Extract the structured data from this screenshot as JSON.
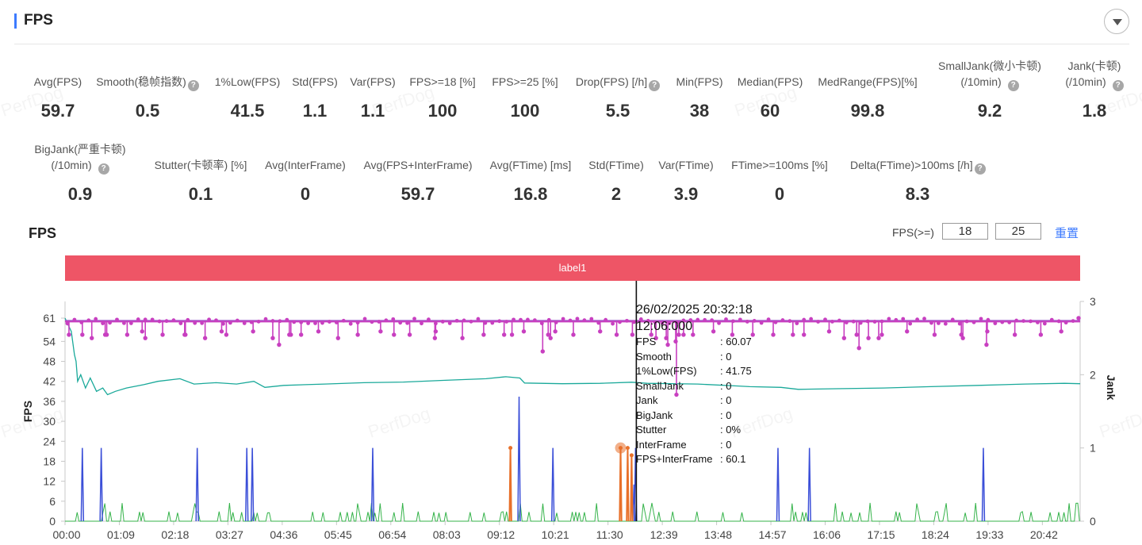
{
  "header": {
    "title": "FPS"
  },
  "metrics_row1": [
    {
      "label": "Avg(FPS)",
      "value": "59.7",
      "help": false
    },
    {
      "label": "Smooth(稳帧指数)",
      "value": "0.5",
      "help": true
    },
    {
      "label": "1%Low(FPS)",
      "value": "41.5",
      "help": false
    },
    {
      "label": "Std(FPS)",
      "value": "1.1",
      "help": false
    },
    {
      "label": "Var(FPS)",
      "value": "1.1",
      "help": false
    },
    {
      "label": "FPS>=18 [%]",
      "value": "100",
      "help": false
    },
    {
      "label": "FPS>=25 [%]",
      "value": "100",
      "help": false
    },
    {
      "label": "Drop(FPS) [/h]",
      "value": "5.5",
      "help": true
    },
    {
      "label": "Min(FPS)",
      "value": "38",
      "help": false
    },
    {
      "label": "Median(FPS)",
      "value": "60",
      "help": false
    },
    {
      "label": "MedRange(FPS)[%]",
      "value": "99.8",
      "help": false
    },
    {
      "label": "SmallJank(微小卡顿)",
      "label2": "(/10min)",
      "value": "9.2",
      "help": true
    },
    {
      "label": "Jank(卡顿)",
      "label2": "(/10min)",
      "value": "1.8",
      "help": true
    }
  ],
  "metrics_row2": [
    {
      "label": "BigJank(严重卡顿)",
      "label2": "(/10min)",
      "value": "0.9",
      "help": true
    },
    {
      "label": "Stutter(卡顿率) [%]",
      "value": "0.1",
      "help": false
    },
    {
      "label": "Avg(InterFrame)",
      "value": "0",
      "help": false
    },
    {
      "label": "Avg(FPS+InterFrame)",
      "value": "59.7",
      "help": false
    },
    {
      "label": "Avg(FTime) [ms]",
      "value": "16.8",
      "help": false
    },
    {
      "label": "Std(FTime)",
      "value": "2",
      "help": false
    },
    {
      "label": "Var(FTime)",
      "value": "3.9",
      "help": false
    },
    {
      "label": "FTime>=100ms [%]",
      "value": "0",
      "help": false
    },
    {
      "label": "Delta(FTime)>100ms [/h]",
      "value": "8.3",
      "help": true
    }
  ],
  "chart_section": {
    "title": "FPS",
    "threshold_label": "FPS(>=)",
    "threshold_low": "18",
    "threshold_high": "25",
    "reset_label": "重置",
    "band_label": "label1",
    "watermark": "PerfDog"
  },
  "tooltip": {
    "datetime": "26/02/2025 20:32:18",
    "elapsed": "12:06:000",
    "rows": [
      {
        "key": "FPS",
        "value": ": 60.07"
      },
      {
        "key": "Smooth",
        "value": ": 0"
      },
      {
        "key": "1%Low(FPS)",
        "value": ": 41.75"
      },
      {
        "key": "SmallJank",
        "value": ": 0"
      },
      {
        "key": "Jank",
        "value": ": 0"
      },
      {
        "key": "BigJank",
        "value": ": 0"
      },
      {
        "key": "Stutter",
        "value": ": 0%"
      },
      {
        "key": "InterFrame",
        "value": ": 0"
      },
      {
        "key": "FPS+InterFrame",
        "value": ": 60.1"
      }
    ]
  },
  "colors": {
    "fps": "#c83fc0",
    "low1": "#1aa99a",
    "jank": "#3b4fd8",
    "bigjank": "#e8702a",
    "smooth": "#35b34a",
    "band": "#ee5566",
    "accent": "#3d7bff"
  },
  "chart_data": {
    "type": "line",
    "xlabel": "",
    "ylabel": "FPS",
    "y2label": "Jank",
    "x_ticks": [
      "00:00",
      "01:09",
      "02:18",
      "03:27",
      "04:36",
      "05:45",
      "06:54",
      "08:03",
      "09:12",
      "10:21",
      "11:30",
      "12:39",
      "13:48",
      "14:57",
      "16:06",
      "17:15",
      "18:24",
      "19:33",
      "20:42"
    ],
    "x_range_minutes": [
      0,
      1290
    ],
    "y_ticks": [
      0,
      6,
      12,
      18,
      24,
      30,
      36,
      42,
      48,
      54,
      61
    ],
    "ylim": [
      0,
      66
    ],
    "y2_ticks": [
      0,
      1,
      2,
      3
    ],
    "y2lim": [
      0,
      3
    ],
    "cursor_minutes": 726,
    "series": [
      {
        "name": "FPS",
        "baseline": 60.07,
        "dips": [
          [
            5,
            56
          ],
          [
            22,
            56
          ],
          [
            34,
            55
          ],
          [
            51,
            56
          ],
          [
            79,
            56
          ],
          [
            102,
            55
          ],
          [
            124,
            56
          ],
          [
            152,
            56
          ],
          [
            178,
            55
          ],
          [
            205,
            56
          ],
          [
            239,
            57
          ],
          [
            264,
            55
          ],
          [
            287,
            56
          ],
          [
            300,
            56
          ],
          [
            322,
            57
          ],
          [
            347,
            55
          ],
          [
            372,
            56
          ],
          [
            401,
            57
          ],
          [
            418,
            56
          ],
          [
            438,
            56
          ],
          [
            471,
            57
          ],
          [
            505,
            55
          ],
          [
            532,
            56
          ],
          [
            558,
            56
          ],
          [
            583,
            57
          ],
          [
            614,
            56
          ],
          [
            646,
            56
          ],
          [
            680,
            57
          ],
          [
            701,
            56
          ],
          [
            721,
            56
          ],
          [
            745,
            56
          ],
          [
            764,
            55
          ],
          [
            780,
            56
          ],
          [
            798,
            56
          ],
          [
            824,
            57
          ],
          [
            848,
            56
          ],
          [
            874,
            56
          ],
          [
            900,
            56
          ],
          [
            925,
            56
          ],
          [
            939,
            56
          ],
          [
            971,
            57
          ],
          [
            990,
            55
          ],
          [
            1006,
            56
          ],
          [
            1038,
            56
          ],
          [
            1070,
            57
          ],
          [
            1105,
            56
          ],
          [
            1139,
            56
          ],
          [
            1172,
            57
          ],
          [
            1207,
            56
          ],
          [
            1240,
            56
          ],
          [
            1266,
            57
          ],
          [
            1288,
            61
          ],
          [
            53,
            56
          ],
          [
            98,
            57
          ],
          [
            153,
            56
          ],
          [
            199,
            57
          ],
          [
            272,
            53
          ],
          [
            285,
            56
          ],
          [
            470,
            55
          ],
          [
            568,
            56
          ],
          [
            607,
            51
          ],
          [
            617,
            55
          ],
          [
            623,
            57
          ],
          [
            751,
            55
          ],
          [
            766,
            53
          ],
          [
            776,
            54
          ],
          [
            786,
            56
          ],
          [
            1009,
            52
          ],
          [
            1021,
            55
          ],
          [
            1034,
            55
          ],
          [
            1141,
            55
          ],
          [
            1171,
            53
          ],
          [
            777,
            38
          ]
        ]
      },
      {
        "name": "1%Low(FPS)",
        "points": [
          [
            0,
            61
          ],
          [
            8,
            57
          ],
          [
            12,
            50
          ],
          [
            14,
            48
          ],
          [
            16,
            42
          ],
          [
            20,
            44
          ],
          [
            26,
            40
          ],
          [
            32,
            43
          ],
          [
            40,
            39
          ],
          [
            48,
            40
          ],
          [
            54,
            38
          ],
          [
            64,
            39
          ],
          [
            78,
            40
          ],
          [
            100,
            41
          ],
          [
            118,
            42
          ],
          [
            146,
            42.8
          ],
          [
            164,
            41.2
          ],
          [
            192,
            41.6
          ],
          [
            218,
            41.2
          ],
          [
            240,
            42
          ],
          [
            254,
            40.2
          ],
          [
            278,
            40.8
          ],
          [
            330,
            41.2
          ],
          [
            380,
            41.6
          ],
          [
            430,
            41.8
          ],
          [
            480,
            42.3
          ],
          [
            535,
            42.8
          ],
          [
            560,
            43.4
          ],
          [
            578,
            43
          ],
          [
            584,
            41.5
          ],
          [
            632,
            41.3
          ],
          [
            680,
            41.4
          ],
          [
            720,
            41.75
          ],
          [
            740,
            41.4
          ],
          [
            804,
            41.2
          ],
          [
            856,
            40.6
          ],
          [
            870,
            40.4
          ],
          [
            910,
            40.2
          ],
          [
            932,
            39.6
          ],
          [
            980,
            39.8
          ],
          [
            1040,
            40
          ],
          [
            1100,
            40.4
          ],
          [
            1160,
            40.8
          ],
          [
            1220,
            41.2
          ],
          [
            1270,
            41.4
          ],
          [
            1290,
            41.3
          ]
        ]
      },
      {
        "name": "Jank",
        "spikes": [
          [
            22,
            1
          ],
          [
            46,
            1
          ],
          [
            168,
            1
          ],
          [
            231,
            1
          ],
          [
            238,
            1
          ],
          [
            391,
            1
          ],
          [
            577,
            1.7
          ],
          [
            620,
            1
          ],
          [
            725,
            1
          ],
          [
            723,
            0.5
          ],
          [
            906,
            1
          ],
          [
            946,
            1
          ],
          [
            1167,
            1
          ]
        ]
      },
      {
        "name": "BigJank",
        "spikes": [
          [
            566,
            1
          ],
          [
            706,
            1
          ],
          [
            715,
            1
          ],
          [
            720,
            0.9
          ]
        ]
      },
      {
        "name": "Smooth",
        "noise_max": 0.25
      }
    ]
  }
}
